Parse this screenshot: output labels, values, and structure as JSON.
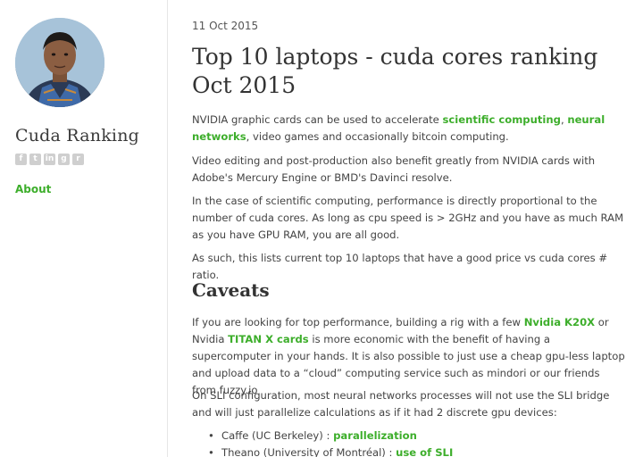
{
  "sidebar": {
    "site_title": "Cuda Ranking",
    "social_icons": [
      "facebook-icon",
      "twitter-icon",
      "linkedin-icon",
      "github-icon",
      "rss-icon"
    ],
    "nav": [
      {
        "label": "About"
      }
    ]
  },
  "post": {
    "date": "11 Oct 2015",
    "title": "Top 10 laptops - cuda cores ranking Oct 2015",
    "p1": {
      "t1": "NVIDIA graphic cards can be used to accelerate ",
      "link1": "scientific computing",
      "t2": ", ",
      "link2": "neural networks",
      "t3": ", video games and occasionally bitcoin computing."
    },
    "p2": "Video editing and post-production also benefit greatly from NVIDIA cards with Adobe's Mercury Engine or BMD's Davinci resolve.",
    "p3": "In the case of scientific computing, performance is directly proportional to the number of cuda cores. As long as cpu speed is > 2GHz and you have as much RAM as you have GPU RAM, you are all good.",
    "p4": "As such, this lists current top 10 laptops that have a good price vs cuda cores # ratio.",
    "caveats_heading": "Caveats",
    "p5": {
      "t1": "If you are looking for top performance, building a rig with a few ",
      "link1": "Nvidia K20X",
      "t2": " or Nvidia ",
      "link2": "TITAN X cards",
      "t3": " is more economic with the benefit of having a supercomputer in your hands. It is also possible to just use a cheap gpu-less laptop and upload data to a “cloud” computing service such as mindori or our friends from fuzzy.io"
    },
    "p6": "On SLI configuration, most neural networks processes will not use the SLI bridge and will just parallelize calculations as if it had 2 discrete gpu devices:",
    "list": [
      {
        "text": "Caffe (UC Berkeley) : ",
        "link": "parallelization"
      },
      {
        "text": "Theano (University of Montréal) : ",
        "link": "use of SLI"
      }
    ]
  },
  "colors": {
    "accent": "#3dae2b",
    "icon_gray": "#cfcfcf"
  }
}
